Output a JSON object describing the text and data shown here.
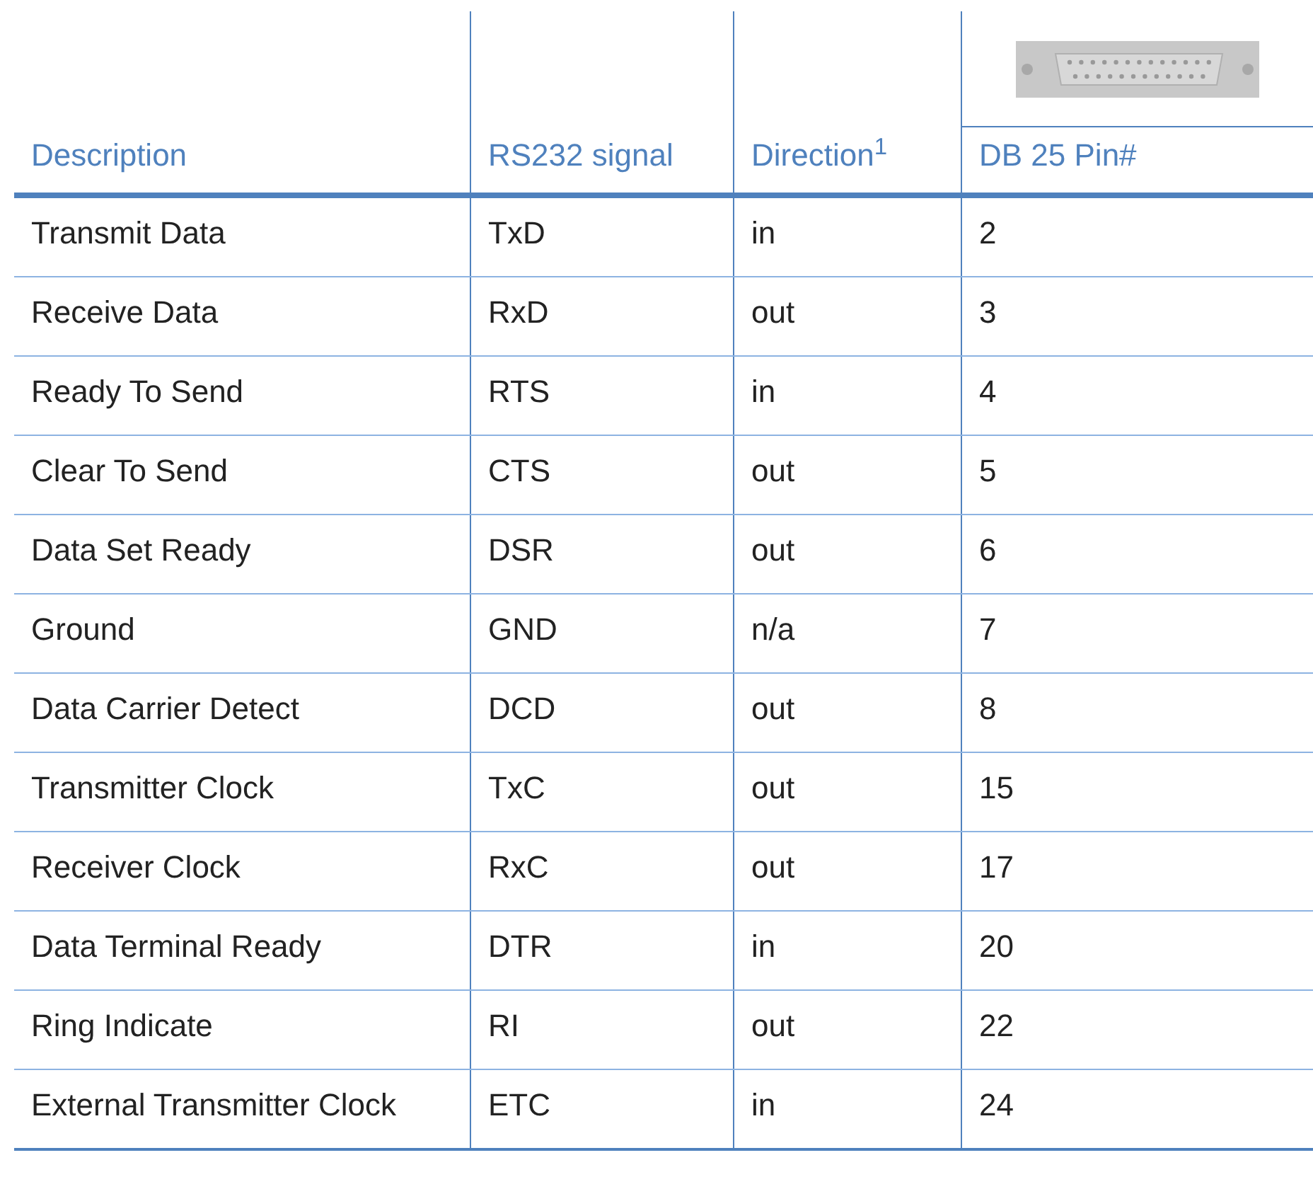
{
  "table": {
    "columns": [
      "Description",
      "RS232 signal",
      "Direction$^{1}$",
      "DB 25 Pin#"
    ],
    "rows": [
      [
        "Transmit Data",
        "TxD",
        "in",
        "2"
      ],
      [
        "Receive Data",
        "RxD",
        "out",
        "3"
      ],
      [
        "Ready To Send",
        "RTS",
        "in",
        "4"
      ],
      [
        "Clear To Send",
        "CTS",
        "out",
        "5"
      ],
      [
        "Data Set Ready",
        "DSR",
        "out",
        "6"
      ],
      [
        "Ground",
        "GND",
        "n/a",
        "7"
      ],
      [
        "Data Carrier Detect",
        "DCD",
        "out",
        "8"
      ],
      [
        "Transmitter Clock",
        "TxC",
        "out",
        "15"
      ],
      [
        "Receiver Clock",
        "RxC",
        "out",
        "17"
      ],
      [
        "Data Terminal Ready",
        "DTR",
        "in",
        "20"
      ],
      [
        "Ring Indicate",
        "RI",
        "out",
        "22"
      ],
      [
        "External Transmitter Clock",
        "ETC",
        "in",
        "24"
      ]
    ]
  }
}
